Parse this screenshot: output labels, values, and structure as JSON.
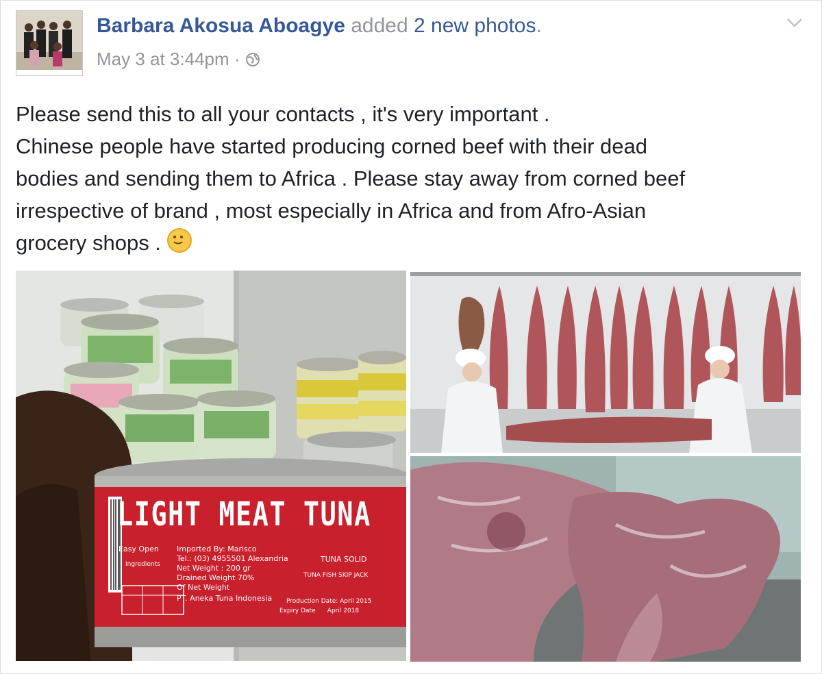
{
  "post": {
    "author": "Barbara Akosua Aboagye",
    "action": "added",
    "photos_count": "2 new photos",
    "trailing_period": ".",
    "timestamp": "May 3 at 3:44pm",
    "separator": "·",
    "privacy_icon": "globe-icon",
    "menu_icon": "chevron-down-icon",
    "text_lines": [
      "Please send this to all your contacts , it's very important .",
      "Chinese people have started producing corned beef with their dead",
      "bodies and sending them to Africa . Please stay away from corned beef",
      "irrespective of brand , most especially in Africa and from Afro-Asian",
      "grocery shops ."
    ],
    "emoji_icon": "face-emoji-icon"
  },
  "photo1": {
    "can_title": "LIGHT MEAT TUNA",
    "easy_open": "Easy Open",
    "imported_by": "Imported By: Marisco",
    "tel": "Tel.: (03) 4955501 Alexandria",
    "net_weight": "Net Weight : 200 gr",
    "drained_weight": "Drained Weight 70%",
    "of_net_weight": "Of Net Weight",
    "producer": "PT. Aneka Tuna Indonesia",
    "tuna_solid": "TUNA SOLID",
    "tuna_fish": "TUNA FISH SKIP JACK",
    "production_date": "Production Date: April 2015",
    "expiry_date": "Expiry Date      April 2018",
    "ingredients": "Ingredients",
    "colors": {
      "can_red": "#c8202c",
      "label_white": "#ffffff"
    }
  }
}
